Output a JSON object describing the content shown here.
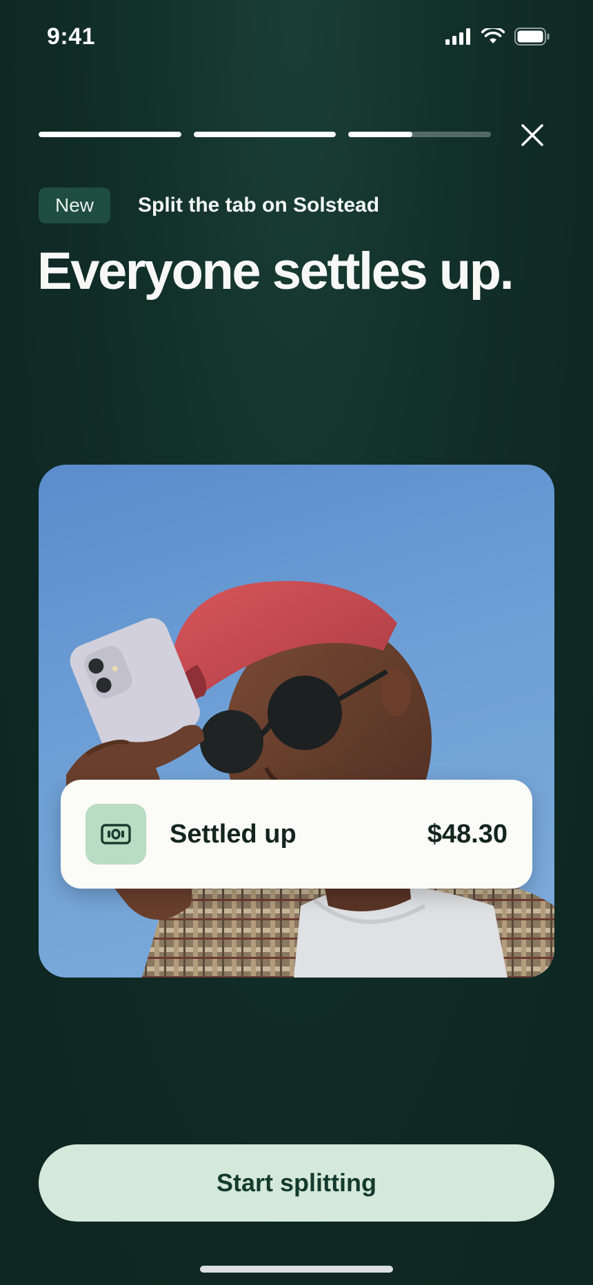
{
  "status_bar": {
    "time": "9:41",
    "icons": [
      "signal-icon",
      "wifi-icon",
      "battery-icon"
    ]
  },
  "progress": {
    "segments": [
      1.0,
      1.0,
      0.45
    ]
  },
  "header": {
    "badge": "New",
    "kicker": "Split the tab on Solstead",
    "headline": "Everyone settles up."
  },
  "settled_card": {
    "icon": "cash-icon",
    "label": "Settled up",
    "amount": "$48.30"
  },
  "cta": {
    "label": "Start splitting"
  },
  "colors": {
    "background": "#12302a",
    "badge_bg": "#1f4d40",
    "cta_bg": "#d5e9da",
    "cta_text": "#143a2f",
    "icon_tile": "#b9dcc3"
  }
}
